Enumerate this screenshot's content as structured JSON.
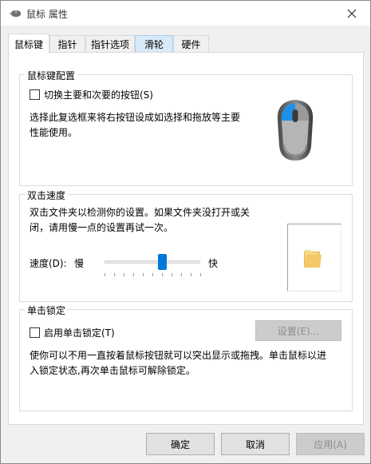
{
  "window": {
    "title": "鼠标 属性"
  },
  "tabs": [
    {
      "label": "鼠标键"
    },
    {
      "label": "指针"
    },
    {
      "label": "指针选项"
    },
    {
      "label": "滑轮"
    },
    {
      "label": "硬件"
    }
  ],
  "button_config": {
    "title": "鼠标键配置",
    "switch_checkbox_label": "切换主要和次要的按钮(S)",
    "switch_checked": false,
    "description_line1": "选择此复选框来将右按钮设成如选择和拖放等主要",
    "description_line2": "性能使用。"
  },
  "double_click": {
    "title": "双击速度",
    "description_line1": "双击文件夹以检测你的设置。如果文件夹没打开或关",
    "description_line2": "闭，请用慢一点的设置再试一次。",
    "speed_label": "速度(D):",
    "slow_label": "慢",
    "fast_label": "快",
    "speed_value_fraction": 0.6
  },
  "click_lock": {
    "title": "单击锁定",
    "checkbox_label": "启用单击锁定(T)",
    "checked": false,
    "settings_button": "设置(E)...",
    "description_line1": "使你可以不用一直按着鼠标按钮就可以突出显示或拖拽。单击鼠标以进",
    "description_line2": "入锁定状态,再次单击鼠标可解除锁定。"
  },
  "footer": {
    "ok": "确定",
    "cancel": "取消",
    "apply": "应用(A)"
  },
  "colors": {
    "accent": "#0078d7",
    "folder": "#f3c866"
  }
}
